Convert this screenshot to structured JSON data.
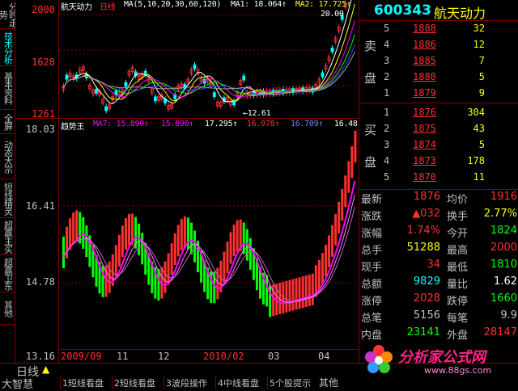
{
  "left_tabs": [
    "分时走势",
    "技术分析",
    "基本资料",
    "全屏",
    "动态大宗",
    "短线精灵",
    "超赢主买",
    "超赢卫东",
    "其他"
  ],
  "axis": {
    "top": [
      "2000",
      "1628",
      "1261"
    ],
    "bottom": [
      "18.03",
      "16.41",
      "14.78",
      "13.16"
    ]
  },
  "top_indicator": {
    "title": "航天动力",
    "period": "日线",
    "ma_label": "MA(5,10,20,30,60,120)",
    "ma1": "MA1: 18.064↑",
    "ma2": "MA2: 17.725↑",
    "high_note": "20.00",
    "low_note": "←12.61"
  },
  "mid_indicator": {
    "title": "趋势王",
    "ma7": "MA7: 15.890↑",
    "v2": "15.890↑",
    "v3": "17.295↑",
    "v4": "16.978↑",
    "v5": "16.709↑",
    "v6": "16.48"
  },
  "dates": [
    "2009/09",
    "11",
    "12",
    "2010/02",
    "03",
    "04"
  ],
  "bottom": {
    "tab": "日线",
    "warn": "▲",
    "app": "大智慧",
    "tabs": [
      "1短线看盘",
      "2短线看盘",
      "3波段操作",
      "4中线看盘",
      "5个股提示"
    ],
    "other": "其他"
  },
  "quote": {
    "code": "600343",
    "name": "航天动力",
    "sell_label": [
      "卖",
      "盘"
    ],
    "buy_label": [
      "买",
      "盘"
    ],
    "sells": [
      {
        "n": "5",
        "p": "1888",
        "v": "32"
      },
      {
        "n": "4",
        "p": "1886",
        "v": "12"
      },
      {
        "n": "3",
        "p": "1885",
        "v": "7"
      },
      {
        "n": "2",
        "p": "1880",
        "v": "5"
      },
      {
        "n": "1",
        "p": "1879",
        "v": "9"
      }
    ],
    "buys": [
      {
        "n": "1",
        "p": "1876",
        "v": "304"
      },
      {
        "n": "2",
        "p": "1875",
        "v": "43"
      },
      {
        "n": "3",
        "p": "1874",
        "v": "5"
      },
      {
        "n": "4",
        "p": "1873",
        "v": "178"
      },
      {
        "n": "5",
        "p": "1870",
        "v": "11"
      }
    ],
    "stats": [
      [
        "最新",
        "1876",
        "均价",
        "1916"
      ],
      [
        "涨跌",
        "▲032",
        "换手",
        "2.77%"
      ],
      [
        "涨幅",
        "1.74%",
        "今开",
        "1824"
      ],
      [
        "总手",
        "51288",
        "最高",
        "2000"
      ],
      [
        "现手",
        "34",
        "最低",
        "1810"
      ],
      [
        "总额",
        "9829",
        "量比",
        "1.62"
      ],
      [
        "涨停",
        "2028",
        "跌停",
        "1660"
      ],
      [
        "总笔",
        "5156",
        "每笔",
        "9.9"
      ],
      [
        "内盘",
        "23141",
        "外盘",
        "28147"
      ]
    ]
  },
  "logo": {
    "text": "分析家公式网",
    "url": "www.88gs.com"
  },
  "colors": {
    "up": "#ff3030",
    "down": "#00ff00",
    "accent": "#00ffff",
    "border": "#800000"
  }
}
